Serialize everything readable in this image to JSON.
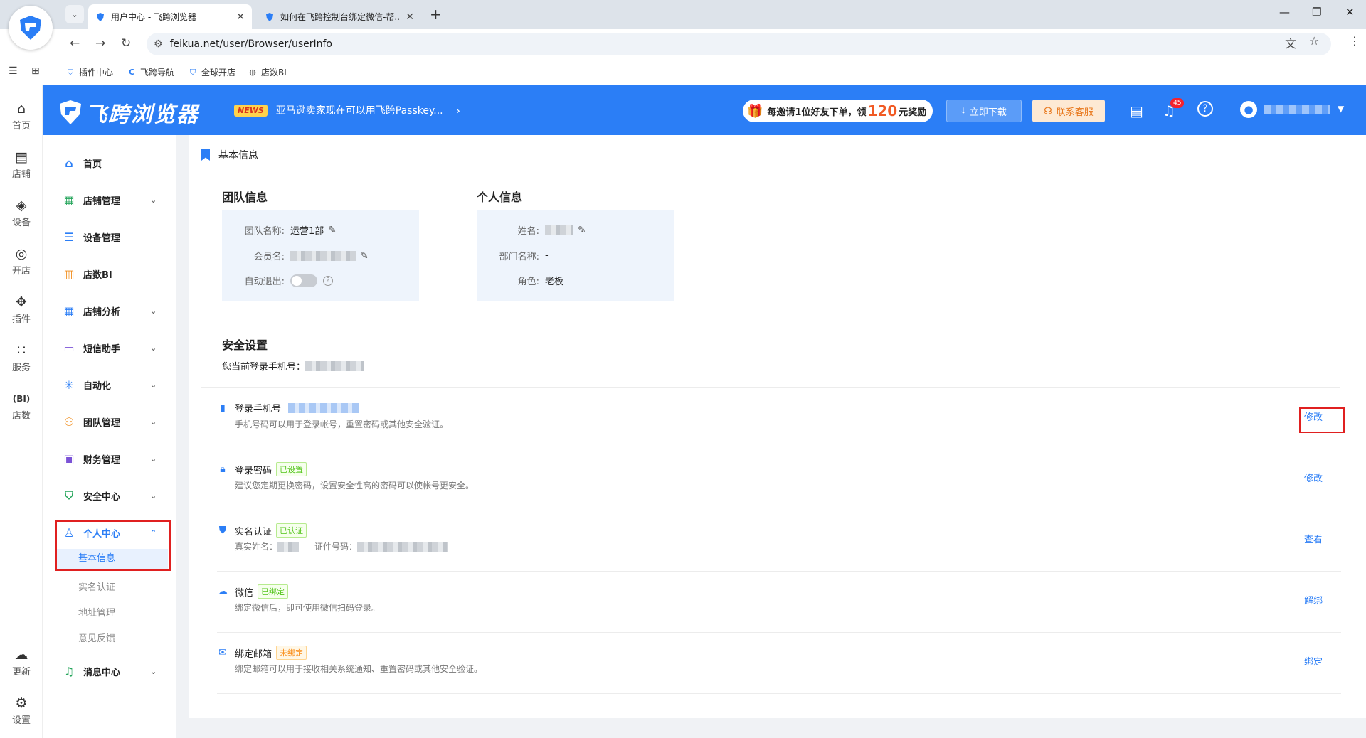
{
  "browser": {
    "tabs": [
      {
        "title": "用户中心 - 飞跨浏览器",
        "active": true
      },
      {
        "title": "如何在飞跨控制台绑定微信-帮...",
        "active": false
      }
    ],
    "url": "feikua.net/user/Browser/userInfo",
    "bookmarks": [
      "插件中心",
      "飞跨导航",
      "全球开店",
      "店数BI"
    ]
  },
  "rail": [
    {
      "label": "首页",
      "icon": "home-icon"
    },
    {
      "label": "店铺",
      "icon": "store-icon"
    },
    {
      "label": "设备",
      "icon": "layers-icon"
    },
    {
      "label": "开店",
      "icon": "planet-icon"
    },
    {
      "label": "插件",
      "icon": "puzzle-icon"
    },
    {
      "label": "服务",
      "icon": "grid-icon"
    },
    {
      "label": "店数",
      "icon": "bi-icon"
    },
    {
      "label": "更新",
      "icon": "cloud-icon"
    },
    {
      "label": "设置",
      "icon": "gear-icon"
    }
  ],
  "header": {
    "logo_text": "飞跨浏览器",
    "news_badge": "NEWS",
    "news_text": "亚马逊卖家现在可以用飞跨Passkey...",
    "invite_prefix": "每邀请1位好友下单，领",
    "invite_num": "120",
    "invite_suffix": "元奖励",
    "download_label": "立即下载",
    "service_label": "联系客服",
    "bell_count": "45",
    "accent": "#2b7ef6"
  },
  "menu": {
    "items": [
      {
        "label": "首页",
        "icon": "home-icon"
      },
      {
        "label": "店铺管理",
        "icon": "store-icon"
      },
      {
        "label": "设备管理",
        "icon": "server-icon"
      },
      {
        "label": "店数BI",
        "icon": "chart-icon"
      },
      {
        "label": "店铺分析",
        "icon": "grid-icon"
      },
      {
        "label": "短信助手",
        "icon": "message-icon"
      },
      {
        "label": "自动化",
        "icon": "snowflake-icon"
      },
      {
        "label": "团队管理",
        "icon": "team-icon"
      },
      {
        "label": "财务管理",
        "icon": "wallet-icon"
      },
      {
        "label": "安全中心",
        "icon": "shield-icon"
      },
      {
        "label": "个人中心",
        "icon": "user-icon"
      }
    ],
    "sub_items": [
      "基本信息",
      "实名认证",
      "地址管理",
      "意见反馈"
    ],
    "last_item": "消息中心"
  },
  "content": {
    "breadcrumb": "基本信息",
    "team": {
      "title": "团队信息",
      "name_label": "团队名称:",
      "name_value": "运营1部",
      "member_label": "会员名:",
      "auto_logout_label": "自动退出:"
    },
    "personal": {
      "title": "个人信息",
      "name_label": "姓名:",
      "dept_label": "部门名称:",
      "dept_value": "-",
      "role_label": "角色:",
      "role_value": "老板"
    },
    "security": {
      "title": "安全设置",
      "phone_hint": "您当前登录手机号：",
      "items": [
        {
          "name": "登录手机号",
          "tag": "",
          "desc": "手机号码可以用于登录帐号，重置密码或其他安全验证。",
          "action": "修改",
          "icon": "phone-icon"
        },
        {
          "name": "登录密码",
          "tag": "已设置",
          "desc": "建议您定期更换密码，设置安全性高的密码可以使帐号更安全。",
          "action": "修改",
          "icon": "lock-icon"
        },
        {
          "name": "实名认证",
          "tag": "已认证",
          "desc_a": "真实姓名：",
          "desc_b": "证件号码：",
          "action": "查看",
          "icon": "verified-shield-icon"
        },
        {
          "name": "微信",
          "tag": "已绑定",
          "desc": "绑定微信后，即可使用微信扫码登录。",
          "action": "解绑",
          "icon": "wechat-icon"
        },
        {
          "name": "绑定邮箱",
          "tag": "未绑定",
          "desc": "绑定邮箱可以用于接收相关系统通知、重置密码或其他安全验证。",
          "action": "绑定",
          "icon": "mail-icon"
        }
      ]
    }
  }
}
